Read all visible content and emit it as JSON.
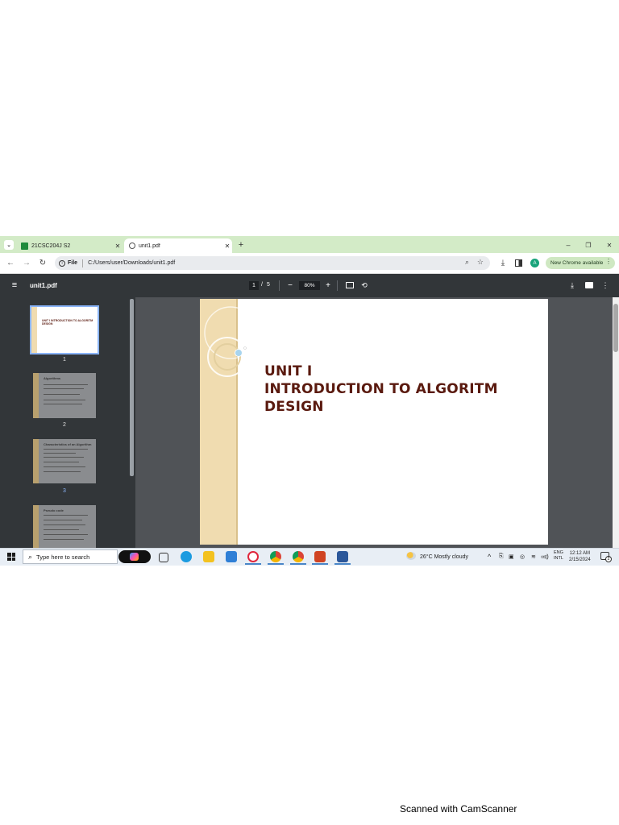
{
  "browser": {
    "tabs": [
      {
        "label": "21CSC204J S2",
        "active": false
      },
      {
        "label": "unit1.pdf",
        "active": true
      }
    ],
    "address": {
      "scheme": "File",
      "url": "C:/Users/user/Downloads/unit1.pdf"
    },
    "new_chrome_label": "New Chrome available",
    "profile_initial": "A"
  },
  "pdf": {
    "filename": "unit1.pdf",
    "page_current": "1",
    "page_separator": "/",
    "page_total": "5",
    "zoom": "80%",
    "page_lines": [
      "UNIT I",
      "INTRODUCTION TO ALGORITM",
      "DESIGN"
    ],
    "thumbnails": [
      {
        "number": "1",
        "title": "UNIT I INTRODUCTION TO ALGORITM DESIGN",
        "selected": true
      },
      {
        "number": "2",
        "title": "Algorithms",
        "selected": false
      },
      {
        "number": "3",
        "title": "Characteristics of an Algorithm",
        "selected": false
      },
      {
        "number": "",
        "title": "Pseudo code",
        "selected": false
      }
    ]
  },
  "taskbar": {
    "search_placeholder": "Type here to search",
    "weather": "26°C  Mostly cloudy",
    "lang_line1": "ENG",
    "lang_line2": "INTL",
    "time": "12:12 AM",
    "date": "2/15/2024",
    "notification_count": "2"
  },
  "footer": "Scanned with CamScanner",
  "colors": {
    "tabbar": "#d3ebc7",
    "pdf_toolbar": "#323639",
    "viewer_bg": "#505357",
    "title_text": "#5a1a0f",
    "page_strip": "#f0dcb0"
  }
}
